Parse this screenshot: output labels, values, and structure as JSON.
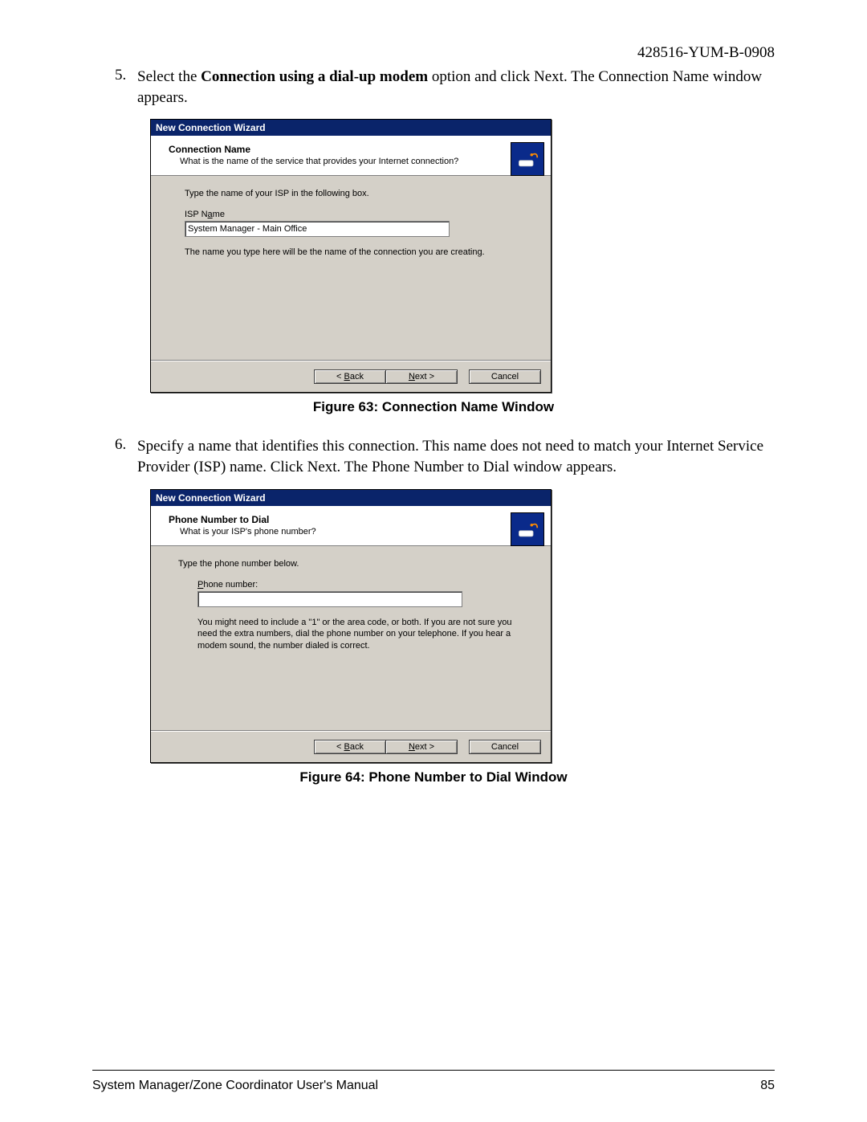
{
  "doc_id": "428516-YUM-B-0908",
  "items": {
    "5": {
      "num": "5.",
      "pre": "Select the ",
      "bold": "Connection using a dial-up modem",
      "post": " option and click Next. The Connection Name window appears."
    },
    "6": {
      "num": "6.",
      "text": "Specify a name that identifies this connection. This name does not need to match your Internet Service Provider (ISP) name. Click Next. The Phone Number to Dial window appears."
    }
  },
  "captions": {
    "fig63": "Figure 63: Connection Name Window",
    "fig64": "Figure 64: Phone Number to Dial Window"
  },
  "wizard1": {
    "title": "New Connection Wizard",
    "header_title": "Connection Name",
    "header_sub": "What is the name of the service that provides your Internet connection?",
    "body_instr": "Type the name of your ISP in the following box.",
    "field_label_pre": "ISP N",
    "field_label_u": "a",
    "field_label_post": "me",
    "input_value": "System Manager - Main Office",
    "hint": "The name you type here will be the name of the connection you are creating."
  },
  "wizard2": {
    "title": "New Connection Wizard",
    "header_title": "Phone Number to Dial",
    "header_sub": "What is your ISP's phone number?",
    "body_instr": "Type the phone number below.",
    "field_label_u": "P",
    "field_label_post": "hone number:",
    "input_value": "",
    "hint": "You might need to include a \"1\" or the area code, or both. If you are not sure you need the extra numbers, dial the phone number on your telephone. If you hear a modem sound, the number dialed is correct."
  },
  "buttons": {
    "back_pre": "< ",
    "back_u": "B",
    "back_post": "ack",
    "next_u": "N",
    "next_post": "ext >",
    "cancel": "Cancel"
  },
  "footer": {
    "left": "System Manager/Zone Coordinator User's Manual",
    "right": "85"
  }
}
